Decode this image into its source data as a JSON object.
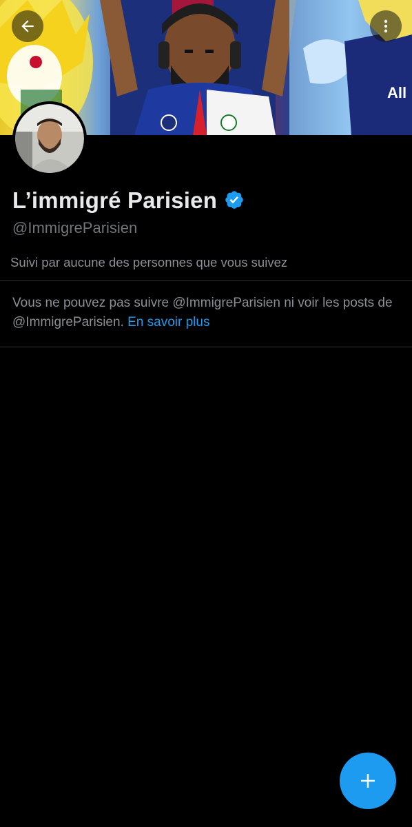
{
  "profile": {
    "display_name": "L’immigré Parisien",
    "handle": "@ImmigreParisien",
    "verified": true,
    "followed_by_text": "Suivi par aucune des personnes que vous suivez"
  },
  "notice": {
    "text": "Vous ne pouvez pas suivre @ImmigreParisien ni voir les posts de @ImmigreParisien.",
    "link_label": "En savoir plus"
  },
  "icons": {
    "back": "arrow-left-icon",
    "more": "more-vertical-icon",
    "verified": "verified-badge-icon",
    "compose": "plus-icon"
  },
  "colors": {
    "background": "#000000",
    "accent": "#1d9bf0",
    "primary_text": "#e7e9ea",
    "secondary_text": "#71767b",
    "divider": "#2f3336"
  }
}
